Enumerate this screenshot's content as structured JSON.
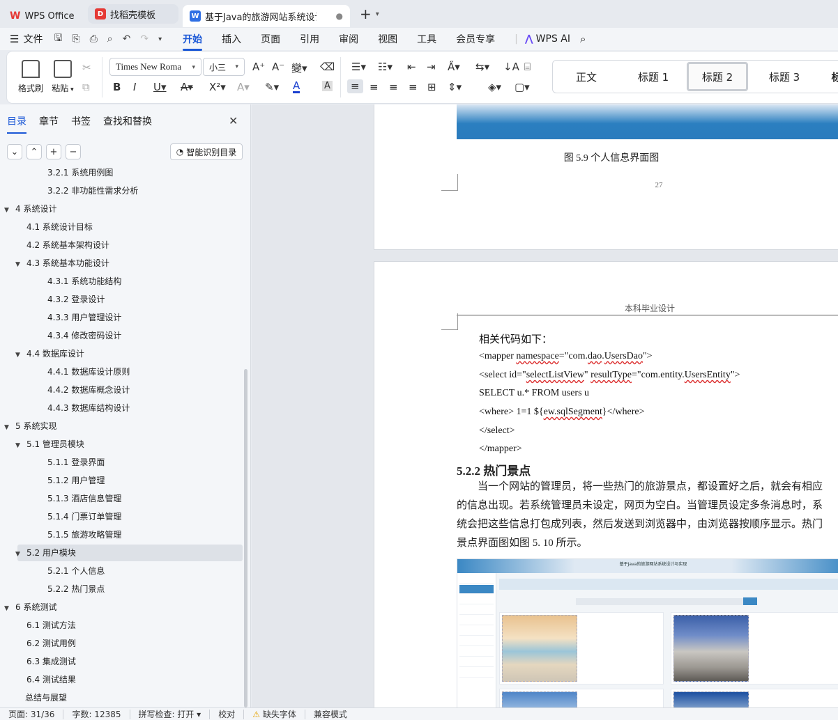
{
  "tabs": [
    {
      "label": "WPS Office"
    },
    {
      "label": "找稻壳模板"
    },
    {
      "label": "基于Java的旅游网站系统设计与实现"
    }
  ],
  "menu": {
    "file": "文件",
    "items": [
      "开始",
      "插入",
      "页面",
      "引用",
      "审阅",
      "视图",
      "工具",
      "会员专享"
    ],
    "ai": "WPS AI"
  },
  "ribbon": {
    "format_painter": "格式刷",
    "paste": "粘贴",
    "font_name": "Times New Roma",
    "font_size": "小三",
    "styles": [
      "正文",
      "标题 1",
      "标题 2",
      "标题 3",
      "标"
    ]
  },
  "nav": {
    "tabs": [
      "目录",
      "章节",
      "书签",
      "查找和替换"
    ],
    "smart_toc": "智能识别目录",
    "toc": [
      {
        "label": "3.2.1  系统用例图",
        "level": 3
      },
      {
        "label": "3.2.2  非功能性需求分析",
        "level": 3
      },
      {
        "label": "4  系统设计",
        "level": 1,
        "arrow": true
      },
      {
        "label": "4.1  系统设计目标",
        "level": 2
      },
      {
        "label": "4.2  系统基本架构设计",
        "level": 2
      },
      {
        "label": "4.3  系统基本功能设计",
        "level": 2,
        "arrow": true
      },
      {
        "label": "4.3.1 系统功能结构",
        "level": 3
      },
      {
        "label": "4.3.2  登录设计",
        "level": 3
      },
      {
        "label": "4.3.3  用户管理设计",
        "level": 3
      },
      {
        "label": "4.3.4  修改密码设计",
        "level": 3
      },
      {
        "label": "4.4  数据库设计",
        "level": 2,
        "arrow": true
      },
      {
        "label": "4.4.1  数据库设计原则",
        "level": 3
      },
      {
        "label": "4.4.2  数据库概念设计",
        "level": 3
      },
      {
        "label": "4.4.3  数据库结构设计",
        "level": 3
      },
      {
        "label": "5  系统实现",
        "level": 1,
        "arrow": true
      },
      {
        "label": "5.1  管理员模块",
        "level": 2,
        "arrow": true
      },
      {
        "label": "5.1.1  登录界面",
        "level": 3
      },
      {
        "label": "5.1.2  用户管理",
        "level": 3
      },
      {
        "label": "5.1.3  酒店信息管理",
        "level": 3
      },
      {
        "label": "5.1.4  门票订单管理",
        "level": 3
      },
      {
        "label": "5.1.5  旅游攻略管理",
        "level": 3
      },
      {
        "label": "5.2  用户模块",
        "level": 2,
        "arrow": true,
        "selected": true
      },
      {
        "label": "5.2.1  个人信息",
        "level": 3
      },
      {
        "label": "5.2.2  热门景点",
        "level": 3
      },
      {
        "label": "6  系统测试",
        "level": 1,
        "arrow": true
      },
      {
        "label": "6.1  测试方法",
        "level": 2
      },
      {
        "label": "6.2  测试用例",
        "level": 2
      },
      {
        "label": "6.3  集成测试",
        "level": 2
      },
      {
        "label": "6.4  测试结果",
        "level": 2
      },
      {
        "label": "总结与展望",
        "level": 0
      }
    ]
  },
  "doc": {
    "figure_caption": "图 5.9  个人信息界面图",
    "page_number": "27",
    "page_header": "本科毕业设计",
    "code_intro": "相关代码如下：",
    "code_lines": [
      "<mapper namespace=\"com.dao.UsersDao\">",
      "<select id=\"selectListView\" resultType=\"com.entity.UsersEntity\">",
      "SELECT u.* FROM users u",
      "<where> 1=1 ${ew.sqlSegment}</where>",
      "</select>",
      "</mapper>"
    ],
    "section_heading": "5.2.2  热门景点",
    "paragraph_lines": [
      "　　当一个网站的管理员，将一些热门的旅游景点，都设置好之后，就会有相应",
      "的信息出现。若系统管理员未设定，网页为空白。当管理员设定多条消息时，系",
      "统会把这些信息打包成列表，然后发送到浏览器中，由浏览器按顺序显示。热门",
      "景点界面图如图 5. 10 所示。"
    ],
    "embedded_title": "基于Java的旅游网站系统设计与实现"
  },
  "status": {
    "page": "页面: 31/36",
    "words": "字数: 12385",
    "spell": "拼写检查: 打开",
    "proof": "校对",
    "missing_font": "缺失字体",
    "compat": "兼容模式"
  }
}
